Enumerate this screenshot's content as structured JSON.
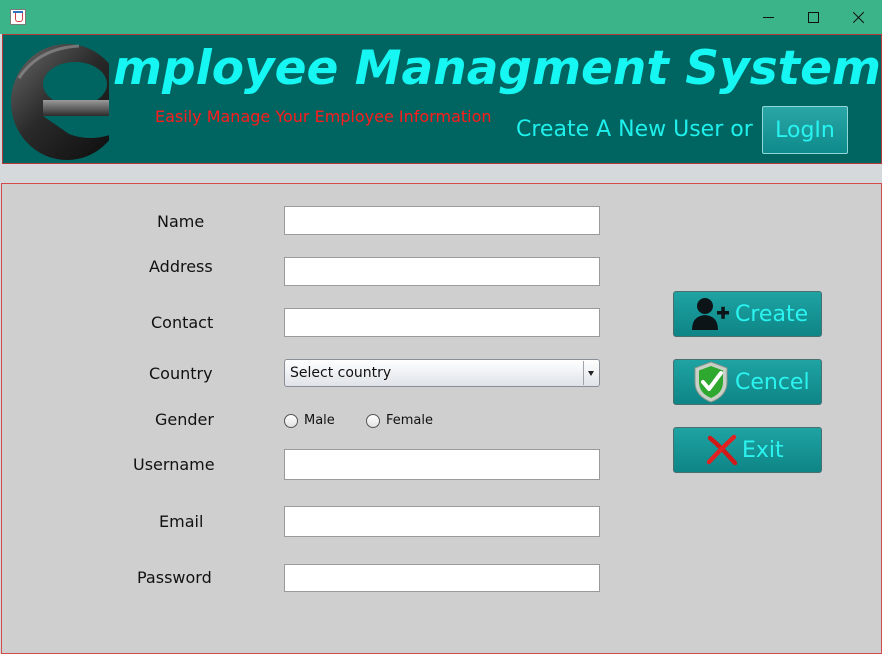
{
  "window": {
    "title": "",
    "controls": {
      "minimize_icon": "minimize-icon",
      "maximize_icon": "maximize-icon",
      "close_icon": "close-icon"
    }
  },
  "banner": {
    "logo_letter": "e",
    "title": "mployee Managment System",
    "subtitle": "Easily Manage Your Employee Information",
    "create_text": "Create A New User or",
    "login_label": "LogIn"
  },
  "form": {
    "labels": {
      "name": "Name",
      "address": "Address",
      "contact": "Contact",
      "country": "Country",
      "gender": "Gender",
      "username": "Username",
      "email": "Email",
      "password": "Password"
    },
    "values": {
      "name": "",
      "address": "",
      "contact": "",
      "username": "",
      "email": "",
      "password": ""
    },
    "country_selected": "Select country",
    "gender_options": [
      "Male",
      "Female"
    ]
  },
  "actions": {
    "create_label": "Create",
    "cancel_label": "Cencel",
    "exit_label": "Exit"
  },
  "colors": {
    "titlebar": "#3cb489",
    "banner_bg": "#006460",
    "title_text": "#16f6f2",
    "subtitle_text": "#ff1c1c",
    "button_bg": "#11999a",
    "panel_bg": "#cfcfcf"
  }
}
